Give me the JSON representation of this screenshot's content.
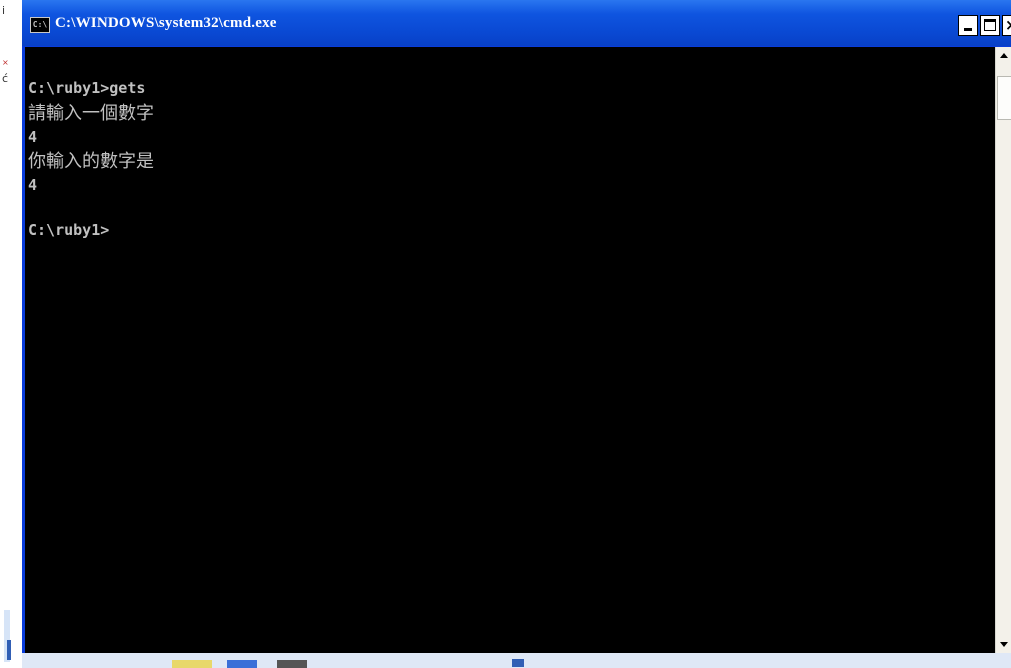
{
  "window": {
    "title": "C:\\WINDOWS\\system32\\cmd.exe",
    "icon_label": "C:\\"
  },
  "title_buttons": {
    "minimize_icon": "minimize-icon",
    "maximize_icon": "maximize-icon",
    "close_glyph": "×"
  },
  "console": {
    "lines": [
      "C:\\ruby1>gets",
      "請輸入一個數字",
      "4",
      "你輸入的數字是",
      "4",
      "",
      "C:\\ruby1>"
    ]
  },
  "desktop": {
    "glyph_1": "i",
    "glyph_2": "×",
    "glyph_3": "ć"
  },
  "colors": {
    "title_bar": "#0a49d3",
    "console_bg": "#000000",
    "console_text": "#c0c0c0"
  }
}
